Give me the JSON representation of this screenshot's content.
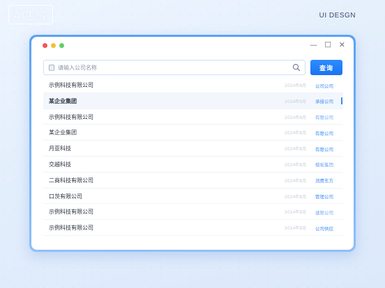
{
  "brand": {
    "logo_text": "AI生成",
    "right_text": "UI DESGN"
  },
  "window": {
    "controls": {
      "minimize": "—",
      "maximize": "☐",
      "close": "✕"
    }
  },
  "search": {
    "placeholder": "请输入公司名称",
    "button_label": "查询"
  },
  "results": [
    {
      "name": "示例科技有限公司",
      "date": "2024年8月",
      "tag": "公司公司"
    },
    {
      "name": "某企业集团",
      "date": "2024年8月",
      "tag": "承接公司",
      "highlight": true
    },
    {
      "name": "示例科技有限公司",
      "date": "2024年8月",
      "tag": "有限公司"
    },
    {
      "name": "某企业集团",
      "date": "2024年8月",
      "tag": "有限公司"
    },
    {
      "name": "月亚科技",
      "date": "2024年8月",
      "tag": "有限公司"
    },
    {
      "name": "交越科技",
      "date": "2024年8月",
      "tag": "模板集团"
    },
    {
      "name": "二商科技有限公司",
      "date": "2024年8月",
      "tag": "消费东方"
    },
    {
      "name": "口茨有限公司",
      "date": "2024年8月",
      "tag": "管理公司"
    },
    {
      "name": "示例科技有限公司",
      "date": "2024年8月",
      "tag": "速限公司"
    },
    {
      "name": "示例科技有限公司",
      "date": "2024年8月",
      "tag": "公司供应"
    }
  ],
  "colors": {
    "accent": "#1a73f0",
    "tag": "#3d8cf0",
    "frame": "#5aa2f5"
  }
}
